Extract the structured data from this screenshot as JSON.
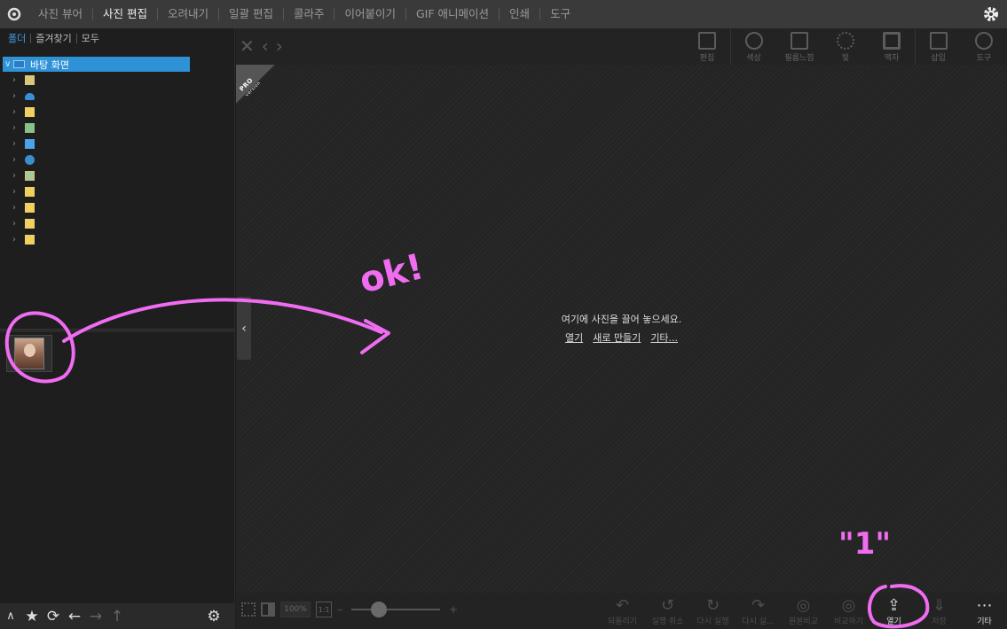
{
  "menu": {
    "items": [
      "사진 뷰어",
      "사진 편집",
      "오려내기",
      "일괄 편집",
      "콜라주",
      "이어붙이기",
      "GIF 애니메이션",
      "인쇄",
      "도구"
    ],
    "active": "사진 편집"
  },
  "left_tabs": [
    "폴더",
    "즐겨찾기",
    "모두"
  ],
  "tree": {
    "root": "바탕 화면",
    "children_count": 11
  },
  "toolbar": [
    "편집",
    "색상",
    "필름느낌",
    "빛",
    "액자",
    "삽입",
    "도구"
  ],
  "pro_badge": {
    "line1": "PRO",
    "line2": "version"
  },
  "drop": {
    "message": "여기에 사진을 끌어 놓으세요.",
    "links": [
      "열기",
      "새로 만들기",
      "기타..."
    ]
  },
  "zoom": {
    "percent": "100%",
    "one_to_one": "1:1",
    "minus": "–",
    "plus": "+"
  },
  "bottom_tools": [
    {
      "label": "되돌리기",
      "icon": "↶"
    },
    {
      "label": "실행 취소",
      "icon": "↺"
    },
    {
      "label": "다시 실행",
      "icon": "↻"
    },
    {
      "label": "다시 실...",
      "icon": "↷"
    },
    {
      "label": "원본비교",
      "icon": "◎"
    },
    {
      "label": "비교하기",
      "icon": "◎"
    },
    {
      "label": "열기",
      "icon": "⇪"
    },
    {
      "label": "저장",
      "icon": "⇓"
    },
    {
      "label": "기타",
      "icon": "⋯"
    }
  ],
  "annotations": {
    "ok": "ok!",
    "one": "\"1\""
  },
  "colors": {
    "accent": "#2f91d6",
    "annotation": "#f06cf0"
  }
}
